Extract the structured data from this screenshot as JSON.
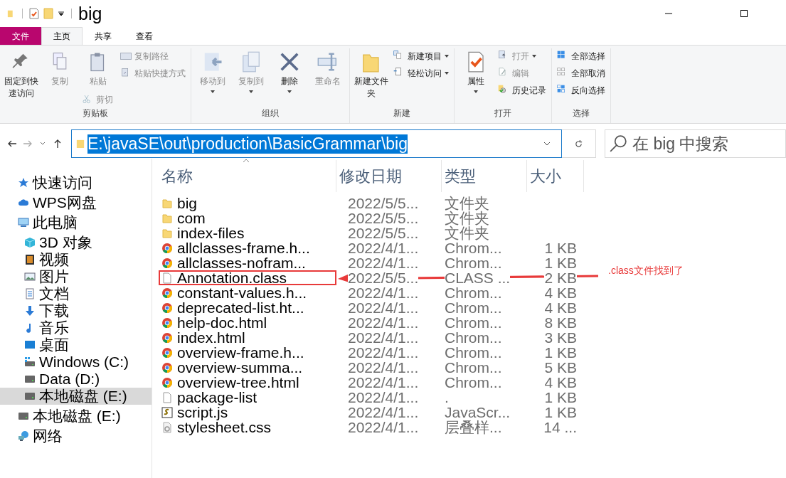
{
  "window": {
    "title": "big"
  },
  "tabs": [
    {
      "label": "文件",
      "kind": "file",
      "selected": false
    },
    {
      "label": "主页",
      "kind": "tab",
      "selected": true
    },
    {
      "label": "共享",
      "kind": "tab",
      "selected": false
    },
    {
      "label": "查看",
      "kind": "tab",
      "selected": false
    }
  ],
  "ribbon": {
    "groups": [
      {
        "label": "剪贴板",
        "columns": [
          [
            {
              "label": "固定到快速访问",
              "kind": "large",
              "disabled": false,
              "dropdown": false
            }
          ],
          [
            {
              "label": "复制",
              "kind": "large",
              "disabled": true,
              "dropdown": false
            }
          ],
          [
            {
              "label": "粘贴",
              "kind": "large",
              "disabled": true,
              "dropdown": false
            },
            {
              "label": "剪切",
              "kind": "small",
              "disabled": true,
              "dropdown": false
            }
          ],
          [
            {
              "label": "复制路径",
              "kind": "small",
              "disabled": true,
              "dropdown": false
            },
            {
              "label": "粘贴快捷方式",
              "kind": "small",
              "disabled": true,
              "dropdown": false
            }
          ]
        ]
      },
      {
        "label": "组织",
        "columns": [
          [
            {
              "label": "移动到",
              "kind": "large",
              "disabled": true,
              "dropdown": true
            }
          ],
          [
            {
              "label": "复制到",
              "kind": "large",
              "disabled": true,
              "dropdown": true
            }
          ],
          [
            {
              "label": "删除",
              "kind": "large",
              "disabled": false,
              "dropdown": true
            }
          ],
          [
            {
              "label": "重命名",
              "kind": "large",
              "disabled": true,
              "dropdown": false
            }
          ]
        ]
      },
      {
        "label": "新建",
        "columns": [
          [
            {
              "label": "新建文件夹",
              "kind": "large",
              "disabled": false,
              "dropdown": false
            }
          ],
          [
            {
              "label": "新建项目",
              "kind": "small",
              "disabled": false,
              "dropdown": true
            },
            {
              "label": "轻松访问",
              "kind": "small",
              "disabled": false,
              "dropdown": true
            }
          ]
        ]
      },
      {
        "label": "打开",
        "columns": [
          [
            {
              "label": "属性",
              "kind": "large",
              "disabled": false,
              "dropdown": true
            }
          ],
          [
            {
              "label": "打开",
              "kind": "small",
              "disabled": true,
              "dropdown": true
            },
            {
              "label": "编辑",
              "kind": "small",
              "disabled": true,
              "dropdown": false
            },
            {
              "label": "历史记录",
              "kind": "small",
              "disabled": false,
              "dropdown": false
            }
          ]
        ]
      },
      {
        "label": "选择",
        "columns": [
          [
            {
              "label": "全部选择",
              "kind": "small",
              "disabled": false,
              "dropdown": false
            },
            {
              "label": "全部取消",
              "kind": "small",
              "disabled": false,
              "dropdown": false
            },
            {
              "label": "反向选择",
              "kind": "small",
              "disabled": false,
              "dropdown": false
            }
          ]
        ]
      }
    ]
  },
  "address": {
    "path": "E:\\javaSE\\out\\production\\BasicGrammar\\big",
    "selected": true
  },
  "search": {
    "placeholder": "在 big 中搜索"
  },
  "sidebar": {
    "items": [
      {
        "label": "快速访问",
        "kind": "star",
        "selected": false
      },
      {
        "label": "WPS网盘",
        "kind": "cloud",
        "selected": false
      },
      {
        "label": "此电脑",
        "kind": "pc",
        "selected": false,
        "children": [
          {
            "label": "3D 对象",
            "kind": "cube",
            "selected": false
          },
          {
            "label": "视频",
            "kind": "film",
            "selected": false
          },
          {
            "label": "图片",
            "kind": "picture",
            "selected": false
          },
          {
            "label": "文档",
            "kind": "document",
            "selected": false
          },
          {
            "label": "下载",
            "kind": "download",
            "selected": false
          },
          {
            "label": "音乐",
            "kind": "music",
            "selected": false
          },
          {
            "label": "桌面",
            "kind": "desktop",
            "selected": false
          },
          {
            "label": "Windows (C:)",
            "kind": "windrive",
            "selected": false
          },
          {
            "label": "Data (D:)",
            "kind": "drive",
            "selected": false
          },
          {
            "label": "本地磁盘 (E:)",
            "kind": "drive",
            "selected": true
          }
        ]
      },
      {
        "label": "本地磁盘 (E:)",
        "kind": "drive",
        "selected": false
      },
      {
        "label": "网络",
        "kind": "network",
        "selected": false
      }
    ]
  },
  "table": {
    "columns": [
      "名称",
      "修改日期",
      "类型",
      "大小"
    ],
    "rows": [
      {
        "name": "big",
        "date": "2022/5/5...",
        "type": "文件夹",
        "size": "",
        "kind": "folder",
        "annotated": false
      },
      {
        "name": "com",
        "date": "2022/5/5...",
        "type": "文件夹",
        "size": "",
        "kind": "folder",
        "annotated": false
      },
      {
        "name": "index-files",
        "date": "2022/5/5...",
        "type": "文件夹",
        "size": "",
        "kind": "folder",
        "annotated": false
      },
      {
        "name": "allclasses-frame.h...",
        "date": "2022/4/1...",
        "type": "Chrom...",
        "size": "1 KB",
        "kind": "chrome",
        "annotated": false
      },
      {
        "name": "allclasses-nofram...",
        "date": "2022/4/1...",
        "type": "Chrom...",
        "size": "1 KB",
        "kind": "chrome",
        "annotated": false
      },
      {
        "name": "Annotation.class",
        "date": "2022/5/5...",
        "type": "CLASS ...",
        "size": "2 KB",
        "kind": "blank",
        "annotated": true
      },
      {
        "name": "constant-values.h...",
        "date": "2022/4/1...",
        "type": "Chrom...",
        "size": "4 KB",
        "kind": "chrome",
        "annotated": false
      },
      {
        "name": "deprecated-list.ht...",
        "date": "2022/4/1...",
        "type": "Chrom...",
        "size": "4 KB",
        "kind": "chrome",
        "annotated": false
      },
      {
        "name": "help-doc.html",
        "date": "2022/4/1...",
        "type": "Chrom...",
        "size": "8 KB",
        "kind": "chrome",
        "annotated": false
      },
      {
        "name": "index.html",
        "date": "2022/4/1...",
        "type": "Chrom...",
        "size": "3 KB",
        "kind": "chrome",
        "annotated": false
      },
      {
        "name": "overview-frame.h...",
        "date": "2022/4/1...",
        "type": "Chrom...",
        "size": "1 KB",
        "kind": "chrome",
        "annotated": false
      },
      {
        "name": "overview-summa...",
        "date": "2022/4/1...",
        "type": "Chrom...",
        "size": "5 KB",
        "kind": "chrome",
        "annotated": false
      },
      {
        "name": "overview-tree.html",
        "date": "2022/4/1...",
        "type": "Chrom...",
        "size": "4 KB",
        "kind": "chrome",
        "annotated": false
      },
      {
        "name": "package-list",
        "date": "2022/4/1...",
        "type": ".",
        "size": "1 KB",
        "kind": "blank",
        "annotated": false
      },
      {
        "name": "script.js",
        "date": "2022/4/1...",
        "type": "JavaScr...",
        "size": "1 KB",
        "kind": "script",
        "annotated": false
      },
      {
        "name": "stylesheet.css",
        "date": "2022/4/1...",
        "type": "层叠样...",
        "size": "14 ...",
        "kind": "css",
        "annotated": false
      }
    ]
  },
  "annotation": {
    "note": ".class文件找到了"
  }
}
